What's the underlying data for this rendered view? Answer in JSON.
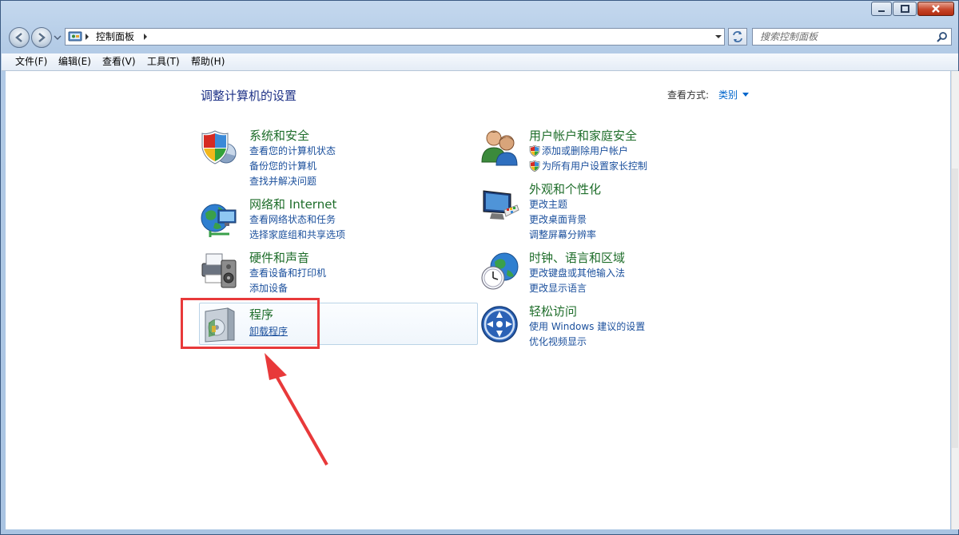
{
  "navbar": {
    "breadcrumb": "控制面板",
    "search_placeholder": "搜索控制面板"
  },
  "menubar": {
    "items": [
      "文件(F)",
      "编辑(E)",
      "查看(V)",
      "工具(T)",
      "帮助(H)"
    ]
  },
  "content": {
    "heading": "调整计算机的设置",
    "view_by_label": "查看方式:",
    "view_by_value": "类别",
    "categories": [
      {
        "title": "系统和安全",
        "icon": "shield-computer-icon",
        "links": [
          "查看您的计算机状态",
          "备份您的计算机",
          "查找并解决问题"
        ]
      },
      {
        "title": "网络和 Internet",
        "icon": "globe-network-icon",
        "links": [
          "查看网络状态和任务",
          "选择家庭组和共享选项"
        ]
      },
      {
        "title": "硬件和声音",
        "icon": "printer-speaker-icon",
        "links": [
          "查看设备和打印机",
          "添加设备"
        ]
      },
      {
        "title": "程序",
        "icon": "programs-box-icon",
        "links": [
          "卸载程序"
        ]
      },
      {
        "title": "用户帐户和家庭安全",
        "icon": "users-icon",
        "links": [
          "添加或删除用户帐户",
          "为所有用户设置家长控制"
        ]
      },
      {
        "title": "外观和个性化",
        "icon": "monitor-palette-icon",
        "links": [
          "更改主题",
          "更改桌面背景",
          "调整屏幕分辨率"
        ]
      },
      {
        "title": "时钟、语言和区域",
        "icon": "clock-globe-icon",
        "links": [
          "更改键盘或其他输入法",
          "更改显示语言"
        ]
      },
      {
        "title": "轻松访问",
        "icon": "ease-of-access-icon",
        "links": [
          "使用 Windows 建议的设置",
          "优化视频显示"
        ]
      }
    ]
  },
  "colors": {
    "category_title": "#1e6d2a",
    "link": "#1a4f9c",
    "heading": "#1e3287",
    "annotation_red": "#e8393a"
  }
}
